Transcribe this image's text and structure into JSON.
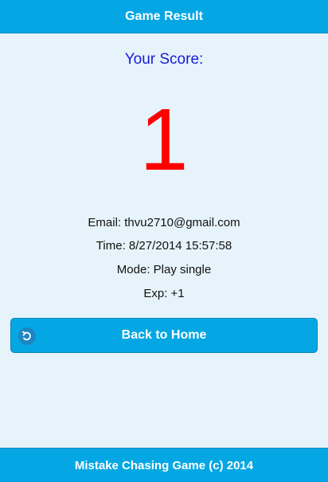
{
  "header": {
    "title": "Game Result"
  },
  "score": {
    "label": "Your Score:",
    "value": "1"
  },
  "details": {
    "email": "Email: thvu2710@gmail.com",
    "time": "Time: 8/27/2014 15:57:58",
    "mode": "Mode: Play single",
    "exp": "Exp: +1"
  },
  "actions": {
    "back_label": "Back to Home",
    "back_icon": "undo-arrow-icon"
  },
  "footer": {
    "text": "Mistake Chasing Game (c) 2014"
  },
  "colors": {
    "bar": "#04a7e3",
    "background": "#e6f3fa",
    "score_label": "#1a1adc",
    "score_value": "#ff0000"
  }
}
